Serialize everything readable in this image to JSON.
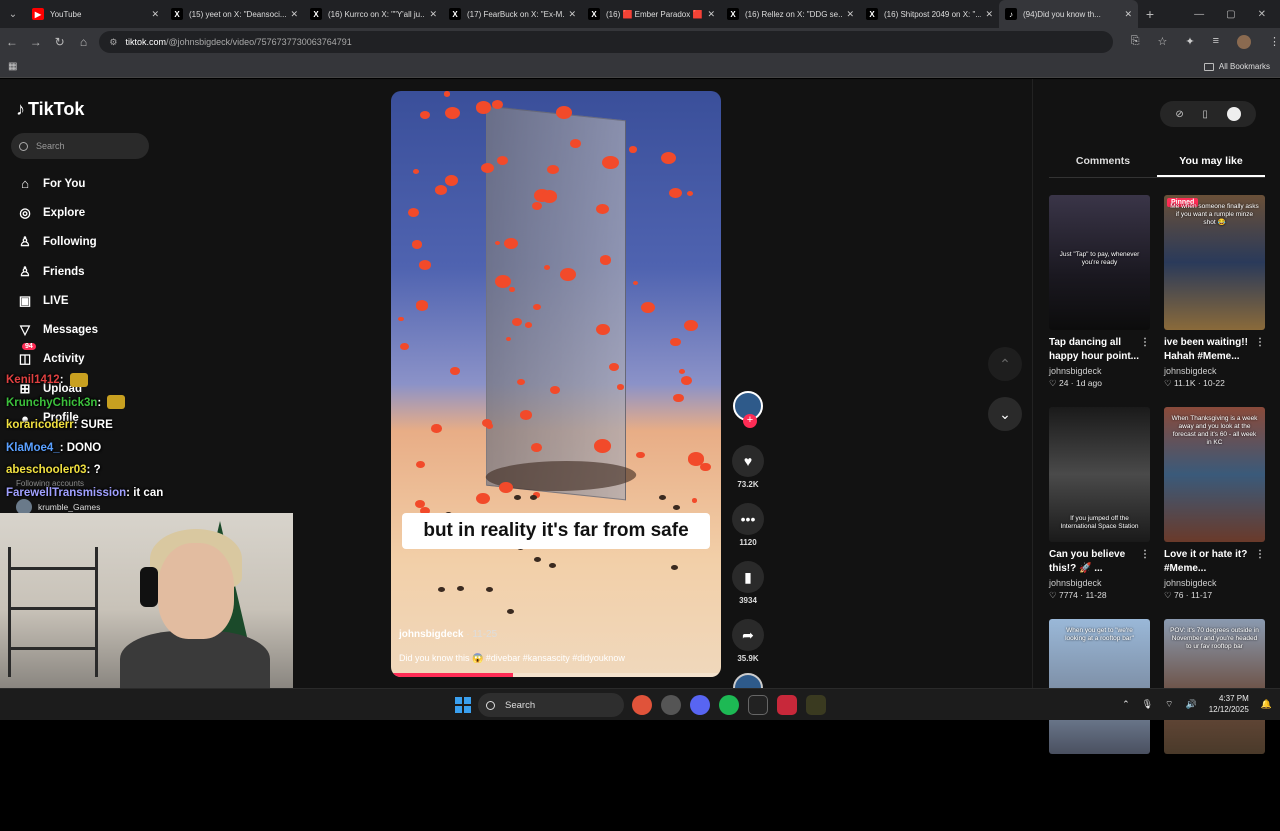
{
  "browser": {
    "tabs": [
      {
        "title": "YouTube",
        "color": "#ff0000",
        "glyph": "▶",
        "active": false
      },
      {
        "title": "(15) yeet on X: \"Deansoci...",
        "color": "#000000",
        "glyph": "X",
        "active": false
      },
      {
        "title": "(16) Kurrco on X: \"\"Y'all ju...",
        "color": "#000000",
        "glyph": "X",
        "active": false
      },
      {
        "title": "(17) FearBuck on X: \"Ex-M...",
        "color": "#000000",
        "glyph": "X",
        "active": false
      },
      {
        "title": "(16) 🟥 Ember Paradox 🟥 ...",
        "color": "#000000",
        "glyph": "X",
        "active": false
      },
      {
        "title": "(16) Rellez on X: \"DDG se...",
        "color": "#000000",
        "glyph": "X",
        "active": false
      },
      {
        "title": "(16) Shitpost 2049 on X: \"...",
        "color": "#000000",
        "glyph": "X",
        "active": false
      },
      {
        "title": "(94)Did you know th...",
        "color": "#000000",
        "glyph": "♪",
        "active": true
      }
    ],
    "url_host": "tiktok.com",
    "url_path": "/@johnsbigdeck/video/7576737730063764791",
    "all_bookmarks": "All Bookmarks"
  },
  "tiktok": {
    "logo": "TikTok",
    "search_placeholder": "Search",
    "nav": [
      {
        "label": "For You",
        "icon": "home-icon",
        "glyph": "⌂"
      },
      {
        "label": "Explore",
        "icon": "compass-icon",
        "glyph": "◎"
      },
      {
        "label": "Following",
        "icon": "following-icon",
        "glyph": "♙"
      },
      {
        "label": "Friends",
        "icon": "friends-icon",
        "glyph": "♙"
      },
      {
        "label": "LIVE",
        "icon": "live-icon",
        "glyph": "▣"
      },
      {
        "label": "Messages",
        "icon": "messages-icon",
        "glyph": "▽"
      },
      {
        "label": "Activity",
        "icon": "activity-icon",
        "glyph": "◫"
      },
      {
        "label": "Upload",
        "icon": "upload-icon",
        "glyph": "⊞"
      },
      {
        "label": "Profile",
        "icon": "profile-icon",
        "glyph": "●"
      }
    ],
    "activity_badge": "94",
    "following_accounts_label": "Following accounts",
    "following_account": "krumble_Games"
  },
  "stream_chat": [
    {
      "user": "Kenil1412",
      "msg": "",
      "userClass": "u1"
    },
    {
      "user": "KrunchyChick3n",
      "msg": "",
      "userClass": "u2"
    },
    {
      "user": "koraricoderr",
      "msg": "SURE",
      "userClass": "u4"
    },
    {
      "user": "KlaMoe4_",
      "msg": "DONO",
      "userClass": "u3"
    },
    {
      "user": "abeschooler03",
      "msg": "?",
      "userClass": "u4"
    },
    {
      "user": "FarewellTransmission",
      "msg": "it can",
      "userClass": "u5"
    }
  ],
  "video": {
    "caption": "but in reality it's far from safe",
    "author": "johnsbigdeck",
    "date": "· 11-25",
    "description": "Did you know this 😱 #divebar #kansascity #didyouknow",
    "progress": 0.37,
    "likes": "73.2K",
    "comments": "1120",
    "saves": "3934",
    "shares": "35.9K"
  },
  "right_panel": {
    "tab_comments": "Comments",
    "tab_you_may_like": "You may like",
    "cards": [
      {
        "title": "Tap dancing all happy hour point...",
        "author": "johnsbigdeck",
        "stats": "♡ 24 · 1d ago",
        "overlay": "Just \"Tap\" to pay, whenever you're ready",
        "pinned": false,
        "bg": "linear-gradient(180deg,#3a3548,#1a1820 60%,#0c0c0c)"
      },
      {
        "title": "ive been waiting!! Hahah #Meme...",
        "author": "johnsbigdeck",
        "stats": "♡ 11.1K · 10-22",
        "overlay": "Me when someone finally asks if you want a rumple minze shot 😂",
        "pinned": true,
        "pinned_label": "Pinned",
        "bg": "linear-gradient(180deg,#6a5038,#2a3a5a 50%,#8a6a3a)"
      },
      {
        "title": "Can you believe this!? 🚀 ...",
        "author": "johnsbigdeck",
        "stats": "♡ 7774 · 11-28",
        "overlay": "If you jumped off the International Space Station",
        "pinned": false,
        "bg": "linear-gradient(180deg,#1a1a1a,#4a4a4a 50%,#1a1a1a)"
      },
      {
        "title": "Love it or hate it? #Meme...",
        "author": "johnsbigdeck",
        "stats": "♡ 76 · 11-17",
        "overlay": "When Thanksgiving is a week away and you look at the forecast and it's 60 - all week in KC",
        "pinned": false,
        "bg": "linear-gradient(180deg,#8a4a3a,#3a5a7a 50%,#6a3a2a)"
      },
      {
        "title": "",
        "author": "",
        "stats": "",
        "overlay": "When you get to \"we're looking at a rooftop bar\"",
        "pinned": false,
        "bg": "linear-gradient(180deg,#9ab8d8,#7a8aa0 60%,#4a5060)"
      },
      {
        "title": "",
        "author": "",
        "stats": "",
        "overlay": "POV: it's 70 degrees outside in November and you're headed to ur fav rooftop bar",
        "pinned": false,
        "bg": "linear-gradient(180deg,#8a9ab0,#6a4a3a 60%,#4a3a2a)"
      }
    ]
  },
  "taskbar": {
    "search": "Search",
    "time": "4:37 PM",
    "date": "12/12/2025"
  },
  "colors": {
    "accent": "#fe2c55",
    "bg": "#121212"
  }
}
